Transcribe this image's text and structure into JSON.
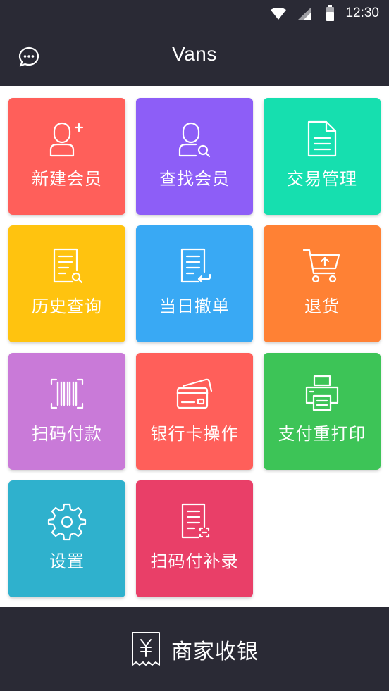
{
  "status": {
    "time": "12:30"
  },
  "header": {
    "title": "Vans"
  },
  "tiles": [
    {
      "label": "新建会员",
      "color": "#ff5f5a",
      "icon": "add-user-icon"
    },
    {
      "label": "查找会员",
      "color": "#8d5ef7",
      "icon": "search-user-icon"
    },
    {
      "label": "交易管理",
      "color": "#16dfaf",
      "icon": "document-icon"
    },
    {
      "label": "历史查询",
      "color": "#ffc30f",
      "icon": "history-search-icon"
    },
    {
      "label": "当日撤单",
      "color": "#39a9f4",
      "icon": "cancel-order-icon"
    },
    {
      "label": "退货",
      "color": "#ff8134",
      "icon": "cart-return-icon"
    },
    {
      "label": "扫码付款",
      "color": "#c97ad8",
      "icon": "barcode-scan-icon"
    },
    {
      "label": "银行卡操作",
      "color": "#ff5f5a",
      "icon": "bank-card-icon"
    },
    {
      "label": "支付重打印",
      "color": "#3dc457",
      "icon": "printer-icon"
    },
    {
      "label": "设置",
      "color": "#2fb1cd",
      "icon": "gear-icon"
    },
    {
      "label": "扫码付补录",
      "color": "#e93f68",
      "icon": "scan-record-icon"
    }
  ],
  "footer": {
    "brand": "商家收银",
    "icon": "receipt-yuan-icon"
  }
}
